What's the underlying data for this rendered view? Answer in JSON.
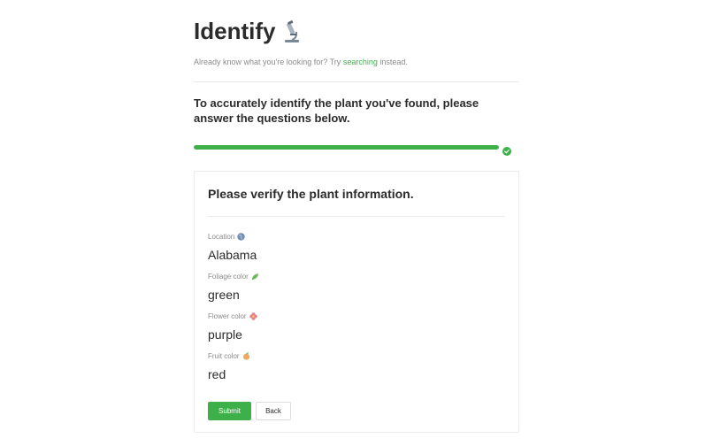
{
  "header": {
    "title": "Identify",
    "title_icon": "microscope-icon",
    "subtitle_prefix": "Already know what you're looking for? Try ",
    "subtitle_link": "searching",
    "subtitle_suffix": " instead."
  },
  "instructions": "To accurately identify the plant you've found, please answer the questions below.",
  "progress": {
    "percent": 100,
    "complete_icon": "check-circle-icon",
    "color": "#3eb049"
  },
  "card": {
    "title": "Please verify the plant information.",
    "fields": [
      {
        "label": "Location",
        "icon": "globe-icon",
        "value": "Alabama"
      },
      {
        "label": "Foliage color",
        "icon": "leaf-icon",
        "value": "green"
      },
      {
        "label": "Flower color",
        "icon": "flower-icon",
        "value": "purple"
      },
      {
        "label": "Fruit color",
        "icon": "fruit-icon",
        "value": "red"
      }
    ],
    "submit_label": "Submit",
    "back_label": "Back"
  },
  "colors": {
    "accent": "#3eb049",
    "text": "#2b2b2b",
    "muted": "#8a8a8a"
  }
}
